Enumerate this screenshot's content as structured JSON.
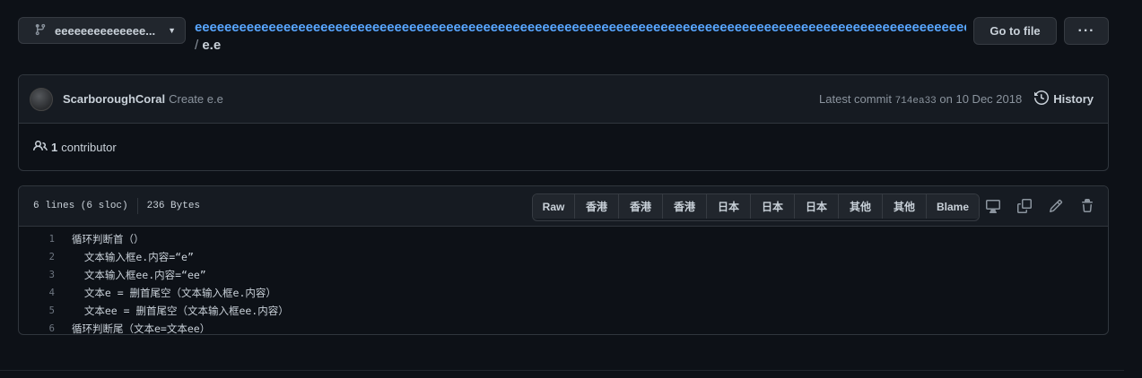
{
  "branch": {
    "label": "eeeeeeeeeeeeee..."
  },
  "breadcrumb": {
    "repo": "eeeeeeeeeeeeeeeeeeeeeeeeeeeeeeeeeeeeeeeeeeeeeeeeeeeeeeeeeeeeeeeeeeeeeeeeeeeeeeeeeeeeeeeeeeeeeeeeeeeeeeeeeee",
    "separator": "/",
    "file": "e.e"
  },
  "actions": {
    "goto_file": "Go to file",
    "more": "···"
  },
  "commit": {
    "author": "ScarboroughCoral",
    "message": "Create e.e",
    "latest_prefix": "Latest commit",
    "sha": "714ea33",
    "date": "on 10 Dec 2018",
    "history_label": "History"
  },
  "contributors": {
    "count": "1",
    "label": "contributor"
  },
  "file": {
    "lines_info": "6 lines (6 sloc)",
    "size": "236 Bytes",
    "buttons": [
      "Raw",
      "香港",
      "香港",
      "香港",
      "日本",
      "日本",
      "日本",
      "其他",
      "其他",
      "Blame"
    ],
    "lines": [
      "循环判断首（）",
      "  文本输入框e.内容=“e”",
      "  文本输入框ee.内容=“ee”",
      "  文本e = 删首尾空（文本输入框e.内容）",
      "  文本ee = 删首尾空（文本输入框ee.内容）",
      "循环判断尾（文本e=文本ee）"
    ]
  },
  "icons": {
    "branch": "git-branch-icon",
    "caret": "triangle-down-icon",
    "history": "history-icon",
    "people": "people-icon",
    "display": "desktop-icon",
    "copy": "copy-icon",
    "edit": "pencil-icon",
    "delete": "trash-icon"
  }
}
